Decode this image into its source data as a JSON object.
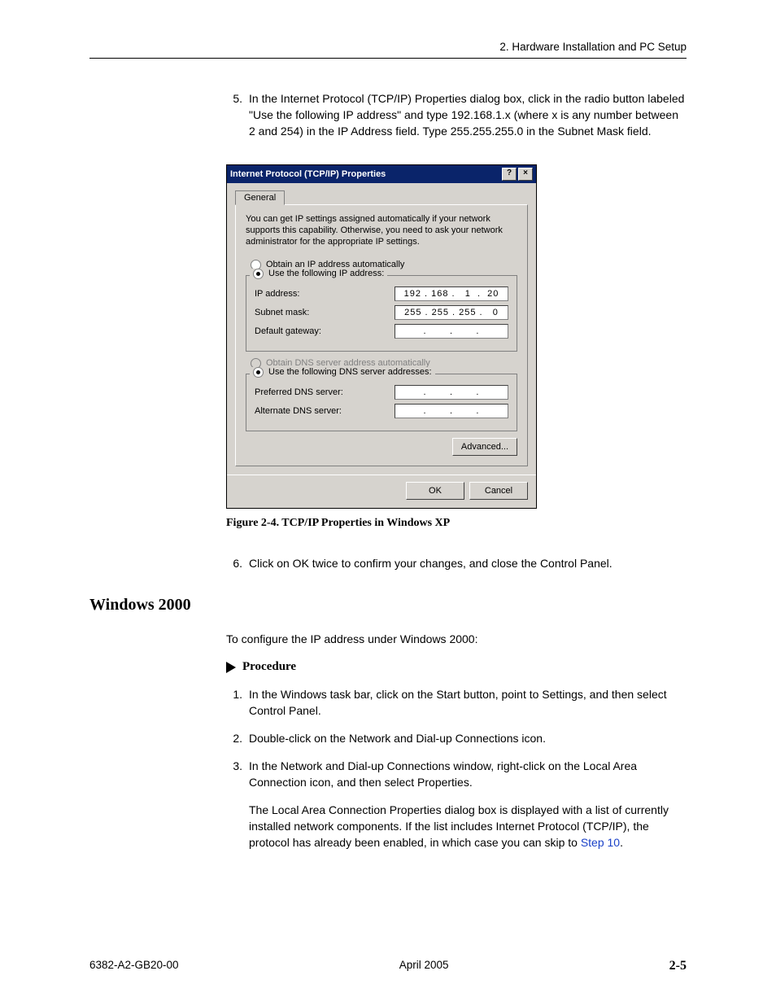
{
  "header": {
    "right": "2. Hardware Installation and PC Setup"
  },
  "step5": {
    "num": "5.",
    "text": "In the Internet Protocol (TCP/IP) Properties dialog box, click in the radio button labeled \"Use the following IP address\" and type 192.168.1.x (where x is any number between 2 and 254) in the IP Address field. Type 255.255.255.0 in the Subnet Mask field."
  },
  "dialog": {
    "title": "Internet Protocol (TCP/IP) Properties",
    "help_btn": "?",
    "close_btn": "×",
    "tab": "General",
    "desc": "You can get IP settings assigned automatically if your network supports this capability. Otherwise, you need to ask your network administrator for the appropriate IP settings.",
    "radio_auto_ip": "Obtain an IP address automatically",
    "radio_use_ip": "Use the following IP address:",
    "ip_label": "IP address:",
    "ip_value": "192 . 168 .   1  .  20",
    "subnet_label": "Subnet mask:",
    "subnet_value": "255 . 255 . 255 .   0",
    "gateway_label": "Default gateway:",
    "gateway_value": " .       .       . ",
    "radio_auto_dns": "Obtain DNS server address automatically",
    "radio_use_dns": "Use the following DNS server addresses:",
    "pref_dns_label": "Preferred DNS server:",
    "pref_dns_value": " .       .       . ",
    "alt_dns_label": "Alternate DNS server:",
    "alt_dns_value": " .       .       . ",
    "advanced_btn": "Advanced...",
    "ok_btn": "OK",
    "cancel_btn": "Cancel"
  },
  "figcaption": "Figure 2-4.    TCP/IP Properties in Windows XP",
  "step6": {
    "num": "6.",
    "text": "Click on OK twice to confirm your changes, and close the Control Panel."
  },
  "section_heading": "Windows 2000",
  "intro_2000": "To configure the IP address under Windows 2000:",
  "procedure_label": "Procedure",
  "proc_steps": [
    {
      "num": "1.",
      "text": "In the Windows task bar, click on the Start button, point to Settings, and then select Control Panel."
    },
    {
      "num": "2.",
      "text": "Double-click on the Network and Dial-up Connections icon."
    },
    {
      "num": "3.",
      "text": "In the Network and Dial-up Connections window, right-click on the Local Area Connection icon, and then select Properties."
    }
  ],
  "proc_para_pre": "The Local Area Connection Properties dialog box is displayed with a list of currently installed network components. If the list includes Internet Protocol (TCP/IP), the protocol has already been enabled, in which case you can skip to ",
  "proc_link": "Step 10",
  "proc_para_post": ".",
  "footer": {
    "left": "6382-A2-GB20-00",
    "center": "April 2005",
    "right": "2-5"
  }
}
